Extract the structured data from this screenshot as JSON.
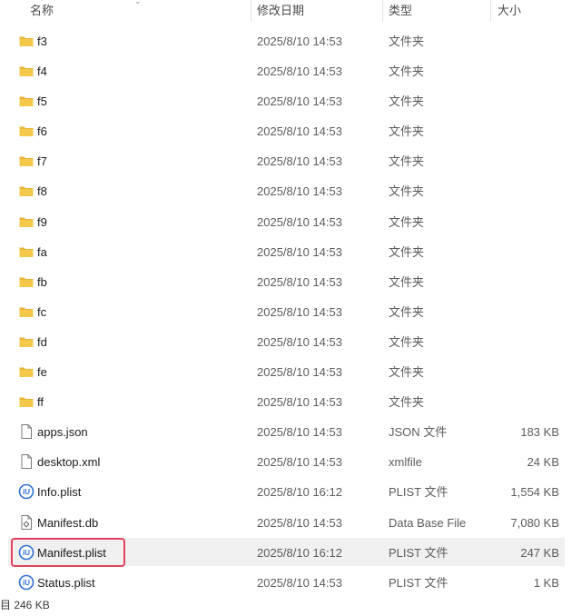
{
  "columns": {
    "name": "名称",
    "modified": "修改日期",
    "type": "类型",
    "size": "大小"
  },
  "rows": [
    {
      "name": "f3",
      "modified": "2025/8/10 14:53",
      "type": "文件夹",
      "size": "",
      "icon": "folder-icon"
    },
    {
      "name": "f4",
      "modified": "2025/8/10 14:53",
      "type": "文件夹",
      "size": "",
      "icon": "folder-icon"
    },
    {
      "name": "f5",
      "modified": "2025/8/10 14:53",
      "type": "文件夹",
      "size": "",
      "icon": "folder-icon"
    },
    {
      "name": "f6",
      "modified": "2025/8/10 14:53",
      "type": "文件夹",
      "size": "",
      "icon": "folder-icon"
    },
    {
      "name": "f7",
      "modified": "2025/8/10 14:53",
      "type": "文件夹",
      "size": "",
      "icon": "folder-icon"
    },
    {
      "name": "f8",
      "modified": "2025/8/10 14:53",
      "type": "文件夹",
      "size": "",
      "icon": "folder-icon"
    },
    {
      "name": "f9",
      "modified": "2025/8/10 14:53",
      "type": "文件夹",
      "size": "",
      "icon": "folder-icon"
    },
    {
      "name": "fa",
      "modified": "2025/8/10 14:53",
      "type": "文件夹",
      "size": "",
      "icon": "folder-icon"
    },
    {
      "name": "fb",
      "modified": "2025/8/10 14:53",
      "type": "文件夹",
      "size": "",
      "icon": "folder-icon"
    },
    {
      "name": "fc",
      "modified": "2025/8/10 14:53",
      "type": "文件夹",
      "size": "",
      "icon": "folder-icon"
    },
    {
      "name": "fd",
      "modified": "2025/8/10 14:53",
      "type": "文件夹",
      "size": "",
      "icon": "folder-icon"
    },
    {
      "name": "fe",
      "modified": "2025/8/10 14:53",
      "type": "文件夹",
      "size": "",
      "icon": "folder-icon"
    },
    {
      "name": "ff",
      "modified": "2025/8/10 14:53",
      "type": "文件夹",
      "size": "",
      "icon": "folder-icon"
    },
    {
      "name": "apps.json",
      "modified": "2025/8/10 14:53",
      "type": "JSON 文件",
      "size": "183 KB",
      "icon": "document-icon"
    },
    {
      "name": "desktop.xml",
      "modified": "2025/8/10 14:53",
      "type": "xmlfile",
      "size": "24 KB",
      "icon": "document-icon"
    },
    {
      "name": "Info.plist",
      "modified": "2025/8/10 16:12",
      "type": "PLIST 文件",
      "size": "1,554 KB",
      "icon": "plist-editor-icon"
    },
    {
      "name": "Manifest.db",
      "modified": "2025/8/10 14:53",
      "type": "Data Base File",
      "size": "7,080 KB",
      "icon": "database-file-icon"
    },
    {
      "name": "Manifest.plist",
      "modified": "2025/8/10 16:12",
      "type": "PLIST 文件",
      "size": "247 KB",
      "icon": "plist-editor-icon",
      "selected": true
    },
    {
      "name": "Status.plist",
      "modified": "2025/8/10 14:53",
      "type": "PLIST 文件",
      "size": "1 KB",
      "icon": "plist-editor-icon"
    }
  ],
  "status_bar": {
    "text": "目 246 KB"
  },
  "colors": {
    "folder": "#f4c84a",
    "selection_bg": "#f0f0f0",
    "highlight_border": "#e0435a",
    "plist_icon": "#2f6fd6"
  }
}
